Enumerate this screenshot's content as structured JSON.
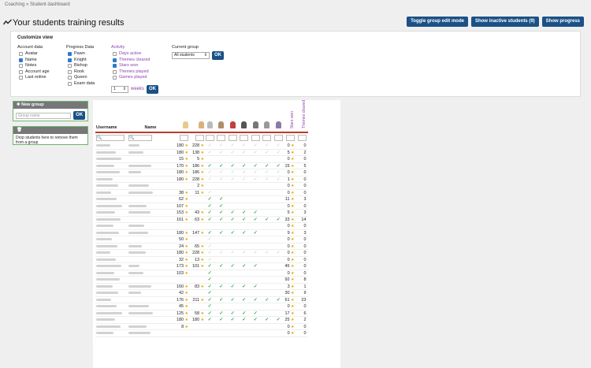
{
  "breadcrumb": "Coaching » Student dashboard",
  "page_title": "Your students training results",
  "buttons": {
    "toggle_edit": "Toggle group edit mode",
    "show_inactive": "Show inactive students (9)",
    "show_progress": "Show progress"
  },
  "customize": {
    "title": "Customize view",
    "account_data": {
      "label": "Account data",
      "items": [
        {
          "label": "Avatar",
          "checked": false
        },
        {
          "label": "Name",
          "checked": true
        },
        {
          "label": "Notes",
          "checked": false
        },
        {
          "label": "Account age",
          "checked": false
        },
        {
          "label": "Last online",
          "checked": false
        }
      ]
    },
    "progress_data": {
      "label": "Progress Data",
      "items": [
        {
          "label": "Pawn",
          "checked": true
        },
        {
          "label": "Knight",
          "checked": true
        },
        {
          "label": "Bishop",
          "checked": false
        },
        {
          "label": "Rook",
          "checked": false
        },
        {
          "label": "Queen",
          "checked": false
        },
        {
          "label": "Exam data",
          "checked": false
        }
      ]
    },
    "activity": {
      "label": "Activity",
      "items": [
        {
          "label": "Days active",
          "checked": false
        },
        {
          "label": "Themes cleared",
          "checked": true
        },
        {
          "label": "Stars won",
          "checked": true
        },
        {
          "label": "Themes played",
          "checked": false
        },
        {
          "label": "Games played",
          "checked": false
        }
      ],
      "weeks_value": "1",
      "weeks_label": "weeks",
      "ok": "OK"
    },
    "current_group": {
      "label": "Current group",
      "value": "All students",
      "ok": "OK"
    }
  },
  "sidebar": {
    "new_group_label": "New group",
    "group_name_placeholder": "Group name",
    "ok": "OK",
    "drop_label": "Drop students here to remove them from a group"
  },
  "table": {
    "headers": {
      "username": "Username",
      "name": "Name",
      "stars_won": "Stars won",
      "themes_cleared": "Themes cleared"
    },
    "rows": [
      {
        "pawn": "180",
        "knight": "228",
        "checks": "LLLLLLL",
        "stars": "0",
        "themes": "0"
      },
      {
        "pawn": "180",
        "knight": "138",
        "checks": "LLLLLLL",
        "stars": "5",
        "themes": "2"
      },
      {
        "pawn": "15",
        "knight": "5",
        "checks": "",
        "stars": "0",
        "themes": "0"
      },
      {
        "pawn": "170",
        "knight": "186",
        "checks": "GGGGGGG",
        "stars": "15",
        "themes": "5"
      },
      {
        "pawn": "180",
        "knight": "186",
        "checks": "LLLLLLL",
        "stars": "0",
        "themes": "0"
      },
      {
        "pawn": "180",
        "knight": "228",
        "checks": "LLLLLLL",
        "stars": "1",
        "themes": "0"
      },
      {
        "pawn": "",
        "knight": "2",
        "checks": "",
        "stars": "0",
        "themes": "0"
      },
      {
        "pawn": "38",
        "knight": "11",
        "checks": "L",
        "stars": "0",
        "themes": "0"
      },
      {
        "pawn": "62",
        "knight": "",
        "checks": "GG",
        "stars": "11",
        "themes": "3"
      },
      {
        "pawn": "107",
        "knight": "",
        "checks": "GG",
        "stars": "0",
        "themes": "0"
      },
      {
        "pawn": "153",
        "knight": "43",
        "checks": "GGGGG",
        "stars": "5",
        "themes": "3"
      },
      {
        "pawn": "161",
        "knight": "63",
        "checks": "GGGGGGG",
        "stars": "33",
        "themes": "14"
      },
      {
        "pawn": "",
        "knight": "",
        "checks": "",
        "stars": "0",
        "themes": "0"
      },
      {
        "pawn": "180",
        "knight": "147",
        "checks": "GGGGG",
        "stars": "9",
        "themes": "3"
      },
      {
        "pawn": "50",
        "knight": "",
        "checks": "L",
        "stars": "0",
        "themes": "0"
      },
      {
        "pawn": "24",
        "knight": "65",
        "checks": "L",
        "stars": "0",
        "themes": "0"
      },
      {
        "pawn": "180",
        "knight": "228",
        "checks": "LLLLLLL",
        "stars": "0",
        "themes": "0"
      },
      {
        "pawn": "32",
        "knight": "13",
        "checks": "L",
        "stars": "0",
        "themes": "0"
      },
      {
        "pawn": "173",
        "knight": "101",
        "checks": "GGGGG",
        "stars": "45",
        "themes": "0"
      },
      {
        "pawn": "103",
        "knight": "",
        "checks": "G",
        "stars": "0",
        "themes": "0"
      },
      {
        "pawn": "",
        "knight": "",
        "checks": "G",
        "stars": "92",
        "themes": "8"
      },
      {
        "pawn": "160",
        "knight": "83",
        "checks": "GGGGG",
        "stars": "3",
        "themes": "1"
      },
      {
        "pawn": "42",
        "knight": "",
        "checks": "G",
        "stars": "30",
        "themes": "9"
      },
      {
        "pawn": "176",
        "knight": "211",
        "checks": "GGGGGGG",
        "stars": "61",
        "themes": "23"
      },
      {
        "pawn": "45",
        "knight": "",
        "checks": "G",
        "stars": "0",
        "themes": "0"
      },
      {
        "pawn": "125",
        "knight": "58",
        "checks": "GGGGG",
        "stars": "17",
        "themes": "6"
      },
      {
        "pawn": "180",
        "knight": "180",
        "checks": "GGGGGGG",
        "stars": "25",
        "themes": "2"
      },
      {
        "pawn": "8",
        "knight": "",
        "checks": "",
        "stars": "0",
        "themes": "0"
      },
      {
        "pawn": "",
        "knight": "",
        "checks": "",
        "stars": "0",
        "themes": "0"
      }
    ]
  },
  "icons": {
    "title": "line-chart-icon",
    "plus": "plus-icon",
    "trash": "trash-icon",
    "search": "search-icon"
  },
  "colors": {
    "button": "#1b5186",
    "check": "#2ea44f",
    "header_rule": "#c0392b",
    "purple_text": "#8e44ad",
    "group_border": "#6db56d"
  }
}
